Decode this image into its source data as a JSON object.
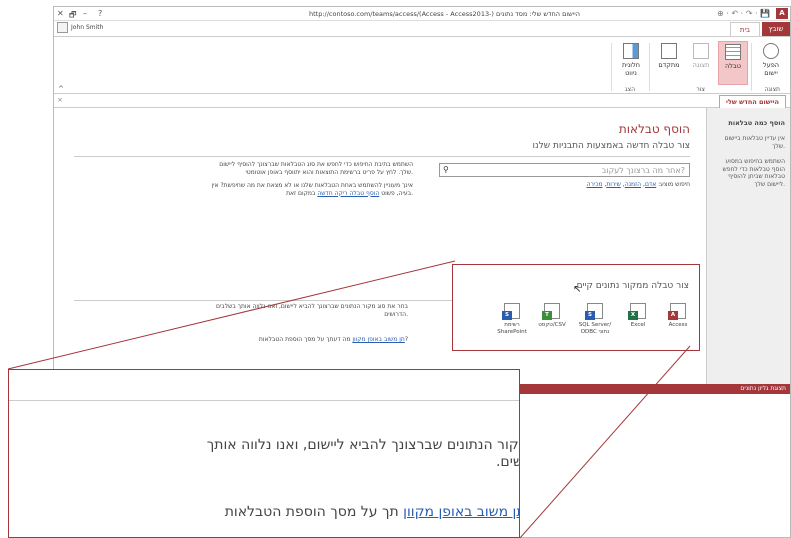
{
  "window": {
    "title_text": "http://contoso.com/teams/access/(Access - Access2013-) היישום החדש שלי: מסד נתונים",
    "help": "?",
    "minimize": "–",
    "restore": "🗗",
    "close": "✕",
    "qat": "⊕ · ↶ · ↷ · 💾"
  },
  "user": {
    "name": "John Smith"
  },
  "app_logo": "A",
  "ribbon": {
    "tabs": {
      "file": "שובץ",
      "home": "בית"
    },
    "buttons": [
      {
        "label": "הפעל יישום",
        "icon": "globe-icon"
      },
      {
        "label": "טבלה",
        "icon": "table-icon"
      },
      {
        "label": "תצוגה",
        "icon": "view-icon"
      },
      {
        "label": "מתקדם",
        "icon": "advanced-icon"
      },
      {
        "label": "חלונית ניווט",
        "icon": "nav-pane-icon"
      }
    ],
    "groups": {
      "view": "תצוגה",
      "create": "צור",
      "show": "הצג"
    },
    "collapse": "^"
  },
  "doc_tab": {
    "label": "היישום החדש שלי",
    "close": "×"
  },
  "nav": {
    "heading": "הוסף כמה טבלאות",
    "p1": "אין עדיין טבלאות ביישום שלך.",
    "p2": "השתמש בחיפוש במסוע הוסף טבלאות כדי לחפש טבלאות שביתן להוסיף ליישום שלך."
  },
  "main": {
    "title": "הוסף טבלאות",
    "subtitle": "צור טבלה חדשה באמצעות התבניות שלנו",
    "search_placeholder": "אחר מה ברצונך לעקוב?",
    "examples_label": "חיפוש מוצע:",
    "examples": [
      "אדם",
      "הזמנה",
      "שירות",
      "מכירה"
    ],
    "help1_a": "השתמש בתיבת החיפוש כדי לחפש את סוג הטבלאות שברצונך להוסיף ליישום שלך. לחץ על פריט ברשימת התוצאות והוא יתווסף באופן אוטומטי.",
    "help1_b": "אינך מעוניין להשתמש באחת הטבלאות שלנו או לא מצאת את מה שחיפשת? אין בעיה, פשוט",
    "help1_link": "הוסף טבלה ריקה חדשה",
    "help1_c": "במקום זאת.",
    "existing_title": "צור טבלה ממקור נתונים קיים",
    "sources": [
      {
        "label": "Access",
        "badge": "A",
        "color": "#a4373a"
      },
      {
        "label": "Excel",
        "badge": "X",
        "color": "#217346"
      },
      {
        "label": "SQL Server/ ODBC נתוני",
        "badge": "S",
        "color": "#2a5db0"
      },
      {
        "label": "טקסט/CSV",
        "badge": "T",
        "color": "#3b8e3b"
      },
      {
        "label": "רשימת SharePoint",
        "badge": "S",
        "color": "#2a5db0"
      }
    ],
    "help2": "בחר את סוג מקור הנתונים שברצונך להביא ליישום, ואנו נלווה אותך בשלבים הדרושים.",
    "help3_prefix": "מה דעתך על מסך הוספת הטבלאות?",
    "help3_link": "תן משוב באופן מקוון"
  },
  "status": {
    "text": "תצוגת גליון נתונים"
  },
  "zoom": {
    "line1": "ת סוג מקור הנתונים שברצונך להביא ליישום, ואנו נלווה אותך",
    "line2": "ם הדרושים.",
    "q_prefix": "תך על מסך הוספת הטבלאות?",
    "q_link": "תן משוב באופן מקוון"
  }
}
